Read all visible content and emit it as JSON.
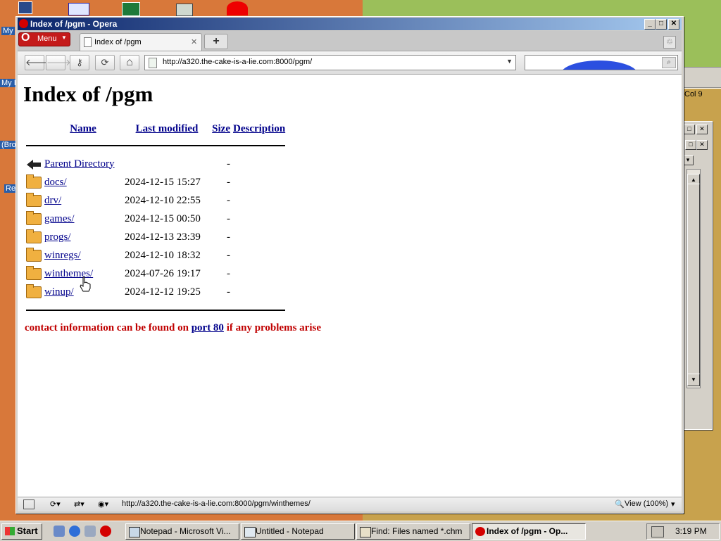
{
  "desktop": {
    "labels": [
      "My",
      "My I",
      "(Bro",
      "Re"
    ],
    "bg_status": "Col 9"
  },
  "window": {
    "title": "Index of /pgm - Opera",
    "minimize": "_",
    "maximize": "□",
    "close": "✕"
  },
  "tabbar": {
    "menu_label": "Menu",
    "tab_title": "Index of /pgm",
    "tab_close": "✕",
    "new_tab": "+"
  },
  "toolbar": {
    "url": "http://a320.the-cake-is-a-lie.com:8000/pgm/",
    "back": "🡐",
    "forward": "🡒",
    "reload": "⟳",
    "home": "⌂"
  },
  "page": {
    "heading": "Index of /pgm",
    "columns": [
      "Name",
      "Last modified",
      "Size",
      "Description"
    ],
    "parent": {
      "name": "Parent Directory",
      "size": "-"
    },
    "entries": [
      {
        "name": "docs/",
        "modified": "2024-12-15 15:27",
        "size": "-"
      },
      {
        "name": "drv/",
        "modified": "2024-12-10 22:55",
        "size": "-"
      },
      {
        "name": "games/",
        "modified": "2024-12-15 00:50",
        "size": "-"
      },
      {
        "name": "progs/",
        "modified": "2024-12-13 23:39",
        "size": "-"
      },
      {
        "name": "winregs/",
        "modified": "2024-12-10 18:32",
        "size": "-"
      },
      {
        "name": "winthemes/",
        "modified": "2024-07-26 19:17",
        "size": "-"
      },
      {
        "name": "winup/",
        "modified": "2024-12-12 19:25",
        "size": "-"
      }
    ],
    "contact_pre": "contact information can be found on ",
    "contact_link": "port 80",
    "contact_post": " if any problems arise"
  },
  "statusbar": {
    "hover_url": "http://a320.the-cake-is-a-lie.com:8000/pgm/winthemes/",
    "view": "View (100%)"
  },
  "taskbar": {
    "start": "Start",
    "tasks": [
      "Notepad - Microsoft Vi...",
      "Untitled - Notepad",
      "Find: Files named *.chm",
      "Index of /pgm - Op..."
    ],
    "clock": "3:19 PM"
  }
}
